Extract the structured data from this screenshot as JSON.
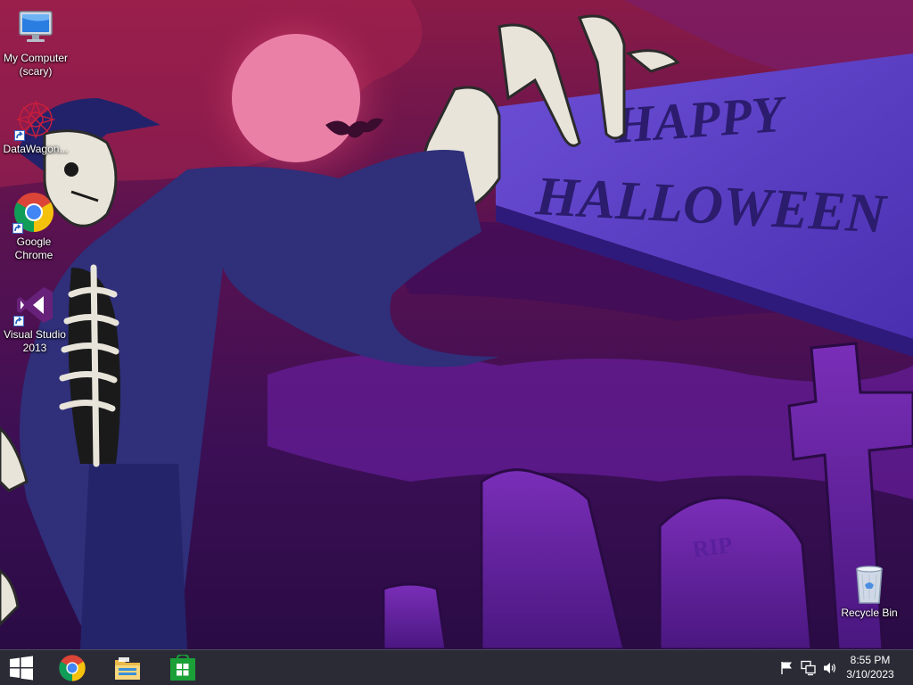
{
  "wallpaper": {
    "sign_line1": "HAPPY",
    "sign_line2": "HALLOWEEN",
    "tombstone_text": "RIP"
  },
  "desktop": {
    "icons": [
      {
        "label": "My Computer\n(scary)",
        "icon": "computer-icon"
      },
      {
        "label": "DataWagon...",
        "icon": "datawagon-icon"
      },
      {
        "label": "Google\nChrome",
        "icon": "chrome-icon"
      },
      {
        "label": "Visual Studio\n2013",
        "icon": "visual-studio-icon"
      },
      {
        "label": "Recycle Bin",
        "icon": "recycle-bin-icon"
      }
    ]
  },
  "taskbar": {
    "pinned": [
      "start-icon",
      "chrome-icon",
      "file-explorer-icon",
      "store-icon"
    ],
    "tray": [
      "action-center-flag-icon",
      "network-icon",
      "volume-icon"
    ],
    "clock": {
      "time": "8:55 PM",
      "date": "3/10/2023"
    }
  },
  "colors": {
    "taskbar": "#2b2b36",
    "accent_purple": "#6a2fa0",
    "moon": "#f08ab0"
  }
}
